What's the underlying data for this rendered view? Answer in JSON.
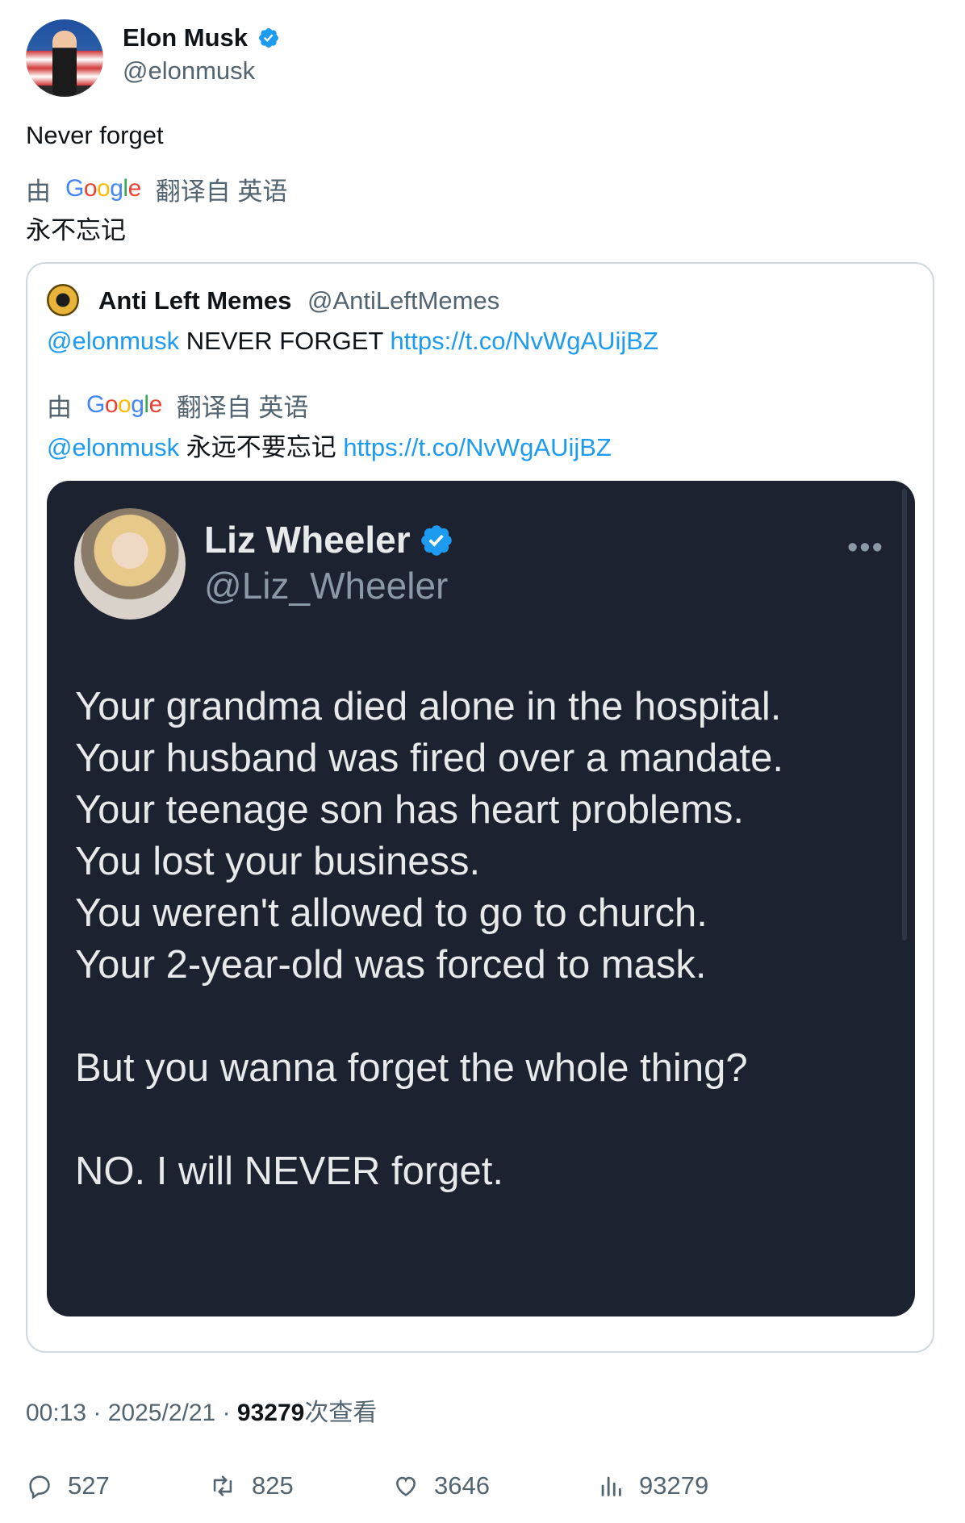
{
  "author": {
    "display_name": "Elon Musk",
    "handle": "@elonmusk",
    "verified": true
  },
  "tweet": {
    "text": "Never forget",
    "translation_prefix": "由",
    "translation_brand": "Google",
    "translation_suffix": "翻译自 英语",
    "translated_text": "永不忘记"
  },
  "quote": {
    "display_name": "Anti Left Memes",
    "handle": "@AntiLeftMemes",
    "mention": "@elonmusk",
    "text": "NEVER FORGET",
    "link": "https://t.co/NvWgAUijBZ",
    "translation_prefix": "由",
    "translation_brand": "Google",
    "translation_suffix": "翻译自 英语",
    "translated_mention": "@elonmusk",
    "translated_text": "永远不要忘记",
    "translated_link": "https://t.co/NvWgAUijBZ",
    "image": {
      "display_name": "Liz Wheeler",
      "handle": "@Liz_Wheeler",
      "more": "•••",
      "lines": [
        "Your grandma died alone in the hospital.",
        "Your husband was fired over a mandate.",
        "Your teenage son has heart problems.",
        "You lost your business.",
        "You weren't allowed to go to church.",
        "Your 2-year-old was forced to mask.",
        "But you wanna forget the whole thing?",
        "NO. I will NEVER forget."
      ]
    }
  },
  "meta": {
    "time": "00:13",
    "date": "2025/2/21",
    "views": "93279",
    "views_suffix": "次查看"
  },
  "actions": {
    "replies": "527",
    "retweets": "825",
    "likes": "3646",
    "views": "93279"
  },
  "colors": {
    "link": "#1d9bf0",
    "verified": "#1d9bf0",
    "muted": "#536471",
    "image_bg": "#1c2230"
  }
}
